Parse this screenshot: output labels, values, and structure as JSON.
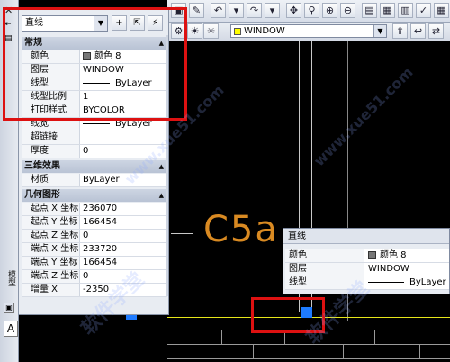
{
  "toolbar": {
    "layer_combo": "WINDOW"
  },
  "canvas": {
    "label_text": "C5a"
  },
  "left_strip": {
    "vertical_label": "模型",
    "letter": "A"
  },
  "palette": {
    "object_type": "直线",
    "sections": {
      "general": "常规",
      "three_d": "三维效果",
      "geometry": "几何图形"
    },
    "general_rows": [
      {
        "label": "颜色",
        "value": "颜色 8"
      },
      {
        "label": "图层",
        "value": "WINDOW"
      },
      {
        "label": "线型",
        "value": "ByLayer"
      },
      {
        "label": "线型比例",
        "value": "1"
      },
      {
        "label": "打印样式",
        "value": "BYCOLOR"
      },
      {
        "label": "线宽",
        "value": "ByLayer"
      },
      {
        "label": "超链接",
        "value": ""
      },
      {
        "label": "厚度",
        "value": "0"
      }
    ],
    "three_d_rows": [
      {
        "label": "材质",
        "value": "ByLayer"
      }
    ],
    "geometry_rows": [
      {
        "label": "起点 X 坐标",
        "value": "236070"
      },
      {
        "label": "起点 Y 坐标",
        "value": "166454"
      },
      {
        "label": "起点 Z 坐标",
        "value": "0"
      },
      {
        "label": "端点 X 坐标",
        "value": "233720"
      },
      {
        "label": "端点 Y 坐标",
        "value": "166454"
      },
      {
        "label": "端点 Z 坐标",
        "value": "0"
      },
      {
        "label": "增量 X",
        "value": "-2350"
      }
    ]
  },
  "quick_props": {
    "title": "直线",
    "rows": [
      {
        "label": "颜色",
        "value": "颜色 8"
      },
      {
        "label": "图层",
        "value": "WINDOW"
      },
      {
        "label": "线型",
        "value": "ByLayer"
      }
    ]
  },
  "watermark": {
    "text1": "软件学堂",
    "text2": "www.xue51.com"
  },
  "colors": {
    "highlight_red": "#d11111",
    "canvas_bg": "#000000",
    "accent_blue": "#1e7bff",
    "label_orange": "#d98a22"
  }
}
